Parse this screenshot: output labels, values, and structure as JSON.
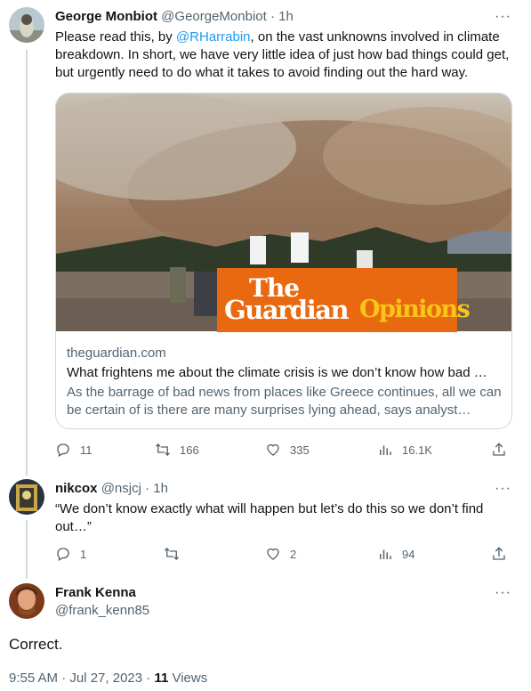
{
  "tweets": [
    {
      "name": "George Monbiot",
      "handle": "@GeorgeMonbiot",
      "time": "1h",
      "text_before": "Please read this, by ",
      "mention": "@RHarrabin",
      "text_after": ", on the vast unknowns involved in climate breakdown. In short, we have very little idea of just how bad things could get, but urgently need to do what it takes to avoid finding out the hard way.",
      "card": {
        "brand_the": "The",
        "brand_guardian": "Guardian",
        "brand_opinions": "Opinions",
        "domain": "theguardian.com",
        "title": "What frightens me about the climate crisis is we don’t know how bad …",
        "description": "As the barrage of bad news from places like Greece continues, all we can be certain of is there are many surprises lying ahead, says analyst…"
      },
      "stats": {
        "replies": "11",
        "retweets": "166",
        "likes": "335",
        "views": "16.1K"
      }
    },
    {
      "name": "nikcox",
      "handle": "@nsjcj",
      "time": "1h",
      "text": "“We don’t know exactly what will happen but let’s do this so we don’t find out…”",
      "stats": {
        "replies": "1",
        "retweets": "",
        "likes": "2",
        "views": "94"
      }
    }
  ],
  "main": {
    "name": "Frank Kenna",
    "handle": "@frank_kenn85",
    "text": "Correct.",
    "timestamp": "9:55 AM · Jul 27, 2023 · ",
    "views_count": "11",
    "views_label": " Views"
  },
  "common": {
    "separator": " · ",
    "more": "···"
  },
  "colors": {
    "accent": "#1d9bf0",
    "guardian_orange": "#e8690f",
    "guardian_yellow": "#f9c51b"
  }
}
